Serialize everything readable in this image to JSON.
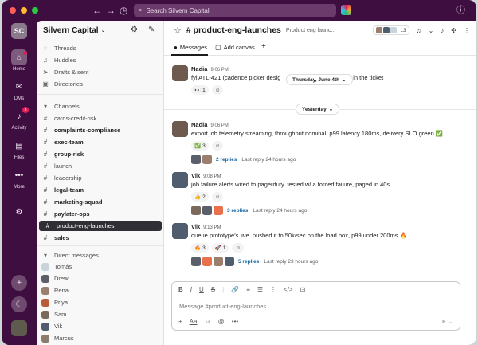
{
  "browser": {
    "search_placeholder": "Search Silvern Capital"
  },
  "workspace": {
    "initials": "SC",
    "name": "Silvern Capital"
  },
  "rail": {
    "items": [
      {
        "label": "Home",
        "icon": "home-icon"
      },
      {
        "label": "DMs",
        "icon": "dms-icon"
      },
      {
        "label": "Activity",
        "icon": "bell-icon",
        "badge": "3"
      },
      {
        "label": "Files",
        "icon": "files-icon"
      },
      {
        "label": "More",
        "icon": "more-icon"
      }
    ]
  },
  "sidebar": {
    "top_items": [
      {
        "label": "Threads",
        "icon": "threads-icon"
      },
      {
        "label": "Huddles",
        "icon": "headphones-icon"
      },
      {
        "label": "Drafts & sent",
        "icon": "send-icon"
      },
      {
        "label": "Directories",
        "icon": "directory-icon"
      }
    ],
    "channels_header": "Channels",
    "channels": [
      {
        "name": "cards-credit-risk",
        "bold": false
      },
      {
        "name": "complaints-compliance",
        "bold": true
      },
      {
        "name": "exec-team",
        "bold": true
      },
      {
        "name": "group-risk",
        "bold": true
      },
      {
        "name": "launch",
        "bold": false
      },
      {
        "name": "leadership",
        "bold": false
      },
      {
        "name": "legal-team",
        "bold": true
      },
      {
        "name": "marketing-squad",
        "bold": true
      },
      {
        "name": "paylater-ops",
        "bold": true
      },
      {
        "name": "product-eng-launches",
        "bold": false,
        "active": true
      },
      {
        "name": "sales",
        "bold": true
      }
    ],
    "dm_header": "Direct messages",
    "dms": [
      {
        "name": "Tomás",
        "color": "#c9d3da"
      },
      {
        "name": "Drew",
        "color": "#5b5f6a"
      },
      {
        "name": "Rena",
        "color": "#9a7f6e"
      },
      {
        "name": "Priya",
        "color": "#b85c3a"
      },
      {
        "name": "Sam",
        "color": "#7b6a5c"
      },
      {
        "name": "Vik",
        "color": "#4f5d6e"
      },
      {
        "name": "Marcus",
        "color": "#8d7c6d"
      }
    ]
  },
  "channel": {
    "name": "# product-eng-launches",
    "description": "Product eng launc...",
    "member_count": "13"
  },
  "tabs": [
    {
      "label": "Messages",
      "icon": "messages-icon"
    },
    {
      "label": "Add canvas",
      "icon": "canvas-icon"
    }
  ],
  "date_pills": {
    "first": "Thursday, June 4th",
    "second": "Yesterday"
  },
  "messages": [
    {
      "author": "Nadia",
      "time": "9:06 PM",
      "text": "fyi ATL-421 (cadence picker desig",
      "text_tail": "s in the ticket",
      "reactions": [
        {
          "emoji": "👀",
          "count": "1"
        }
      ]
    },
    {
      "author": "Nadia",
      "time": "9:06 PM",
      "text": "export job telemetry streaming, throughput nominal, p99 latency 180ms, delivery SLO green ✅",
      "reactions": [
        {
          "emoji": "✅",
          "count": "3"
        }
      ],
      "replies": "2 replies",
      "last_reply": "Last reply 24 hours ago"
    },
    {
      "author": "Vik",
      "time": "9:08 PM",
      "text": "job failure alerts wired to pagerduty. tested w/ a forced failure, paged in 40s",
      "reactions": [
        {
          "emoji": "👍",
          "count": "2"
        }
      ],
      "replies": "3 replies",
      "last_reply": "Last reply 24 hours ago"
    },
    {
      "author": "Vik",
      "time": "9:13 PM",
      "text": "queue prototype's live. pushed it to 50k/sec on the load box, p99 under 200ms 🔥",
      "reactions": [
        {
          "emoji": "🔥",
          "count": "3"
        },
        {
          "emoji": "🚀",
          "count": "1"
        }
      ],
      "replies": "5 replies",
      "last_reply": "Last reply 23 hours ago"
    }
  ],
  "composer": {
    "placeholder": "Message #product-eng-launches",
    "format_icons": [
      "B",
      "I",
      "U",
      "S"
    ],
    "aa_label": "Aa"
  },
  "colors": {
    "aubergine": "#4a154b",
    "link": "#1264a3",
    "active_channel": "#2f2f35"
  }
}
